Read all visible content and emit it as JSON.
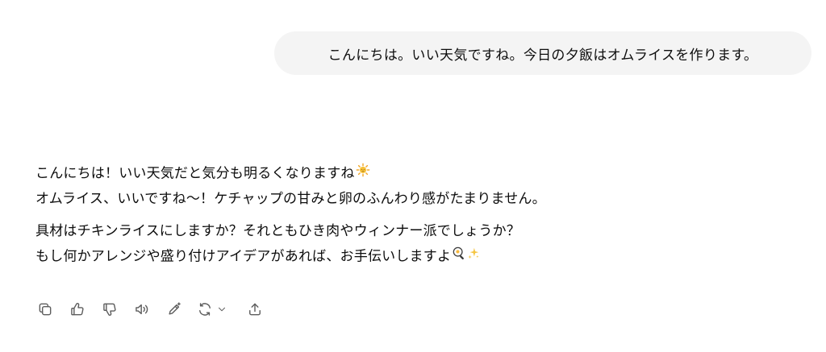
{
  "conversation": {
    "user_message": "こんにちは。いい天気ですね。今日の夕飯はオムライスを作ります。",
    "assistant": {
      "paragraph1": {
        "line1": "こんにちは！いい天気だと気分も明るくなりますね",
        "line1_emoji": "sun-emoji",
        "line2": "オムライス、いいですね〜！ケチャップの甘みと卵のふんわり感がたまりません。"
      },
      "paragraph2": {
        "line1": "具材はチキンライスにしますか？それともひき肉やウィンナー派でしょうか？",
        "line2": "もし何かアレンジや盛り付けアイデアがあれば、お手伝いしますよ",
        "line2_emojis": [
          "frying-pan-egg-emoji",
          "sparkles-emoji"
        ]
      }
    }
  },
  "action_bar": {
    "icons": [
      "copy-icon",
      "thumbs-up-icon",
      "thumbs-down-icon",
      "read-aloud-icon",
      "edit-icon",
      "regenerate-icon",
      "chevron-down-icon",
      "share-icon"
    ]
  },
  "colors": {
    "bubble_bg": "#f4f4f4",
    "text": "#0d0d0d",
    "icon": "#5d5d5d"
  }
}
